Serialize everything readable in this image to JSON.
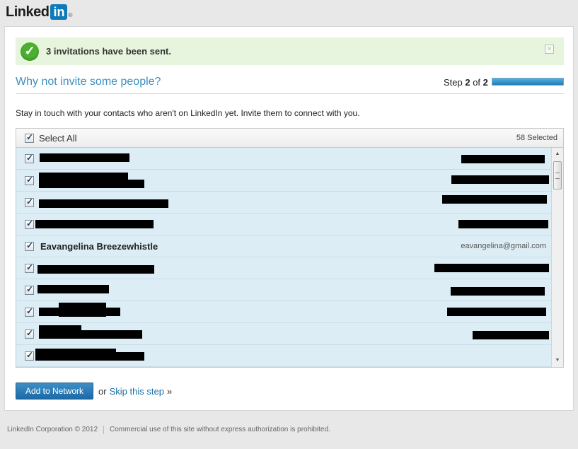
{
  "brand": {
    "wordmark": "Linked",
    "badge": "in",
    "reg": "®"
  },
  "notice": {
    "icon": "check-circle-icon",
    "text": "3 invitations have been sent.",
    "close": "×"
  },
  "title": "Why not invite some people?",
  "step": {
    "prefix": "Step ",
    "current": "2",
    "of": " of ",
    "total": "2",
    "progress": 1.0
  },
  "intro": "Stay in touch with your contacts who aren't on LinkedIn yet. Invite them to connect with you.",
  "list": {
    "select_all": "Select All",
    "selected_count": "58 Selected",
    "rows": [
      {
        "name": "",
        "email": "",
        "checked": true
      },
      {
        "name": "",
        "email": "",
        "checked": true
      },
      {
        "name": "",
        "email": "",
        "checked": true
      },
      {
        "name": "",
        "email": "",
        "checked": true
      },
      {
        "name": "Eavangelina Breezewhistle",
        "email": "eavangelina@gmail.com",
        "checked": true
      },
      {
        "name": "",
        "email": "",
        "checked": true
      },
      {
        "name": "",
        "email": "",
        "checked": true
      },
      {
        "name": "",
        "email": "",
        "checked": true
      },
      {
        "name": "",
        "email": "",
        "checked": true
      },
      {
        "name": "",
        "email": "",
        "checked": true
      }
    ]
  },
  "actions": {
    "add_button": "Add to Network",
    "or": "or",
    "skip": "Skip this step",
    "raquo": "»"
  },
  "footer": {
    "copyright": "LinkedIn Corporation © 2012",
    "notice": "Commercial use of this site without express authorization is prohibited."
  },
  "colors": {
    "accent": "#3d8fbf",
    "button": "#1c6aa6",
    "row_bg": "#dcedf5",
    "notice_bg": "#e7f5df"
  }
}
